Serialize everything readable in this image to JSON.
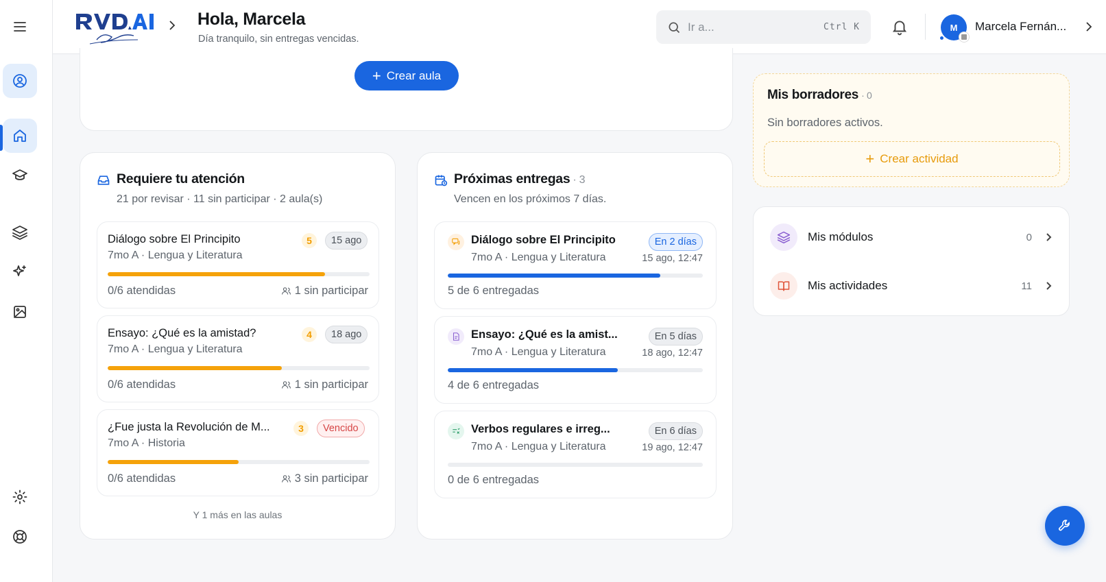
{
  "header": {
    "title": "Hola, Marcela",
    "subtitle": "Día tranquilo, sin entregas vencidas.",
    "search_placeholder": "Ir a...",
    "search_shortcut": "Ctrl K",
    "user_initial": "M",
    "user_name": "Marcela Fernán..."
  },
  "create_classroom_label": "Crear aula",
  "attention": {
    "title": "Requiere tu atención",
    "subtitle": "21 por revisar · 11 sin participar · 2 aula(s)",
    "items": [
      {
        "title": "Diálogo sobre El Principito",
        "meta": "7mo A · Lengua y Literatura",
        "count": "5",
        "date": "15 ago",
        "progress": 0.83,
        "attended": "0/6 atendidas",
        "missing": "1 sin participar"
      },
      {
        "title": "Ensayo: ¿Qué es la amistad?",
        "meta": "7mo A · Lengua y Literatura",
        "count": "4",
        "date": "18 ago",
        "progress": 0.665,
        "attended": "0/6 atendidas",
        "missing": "1 sin participar"
      },
      {
        "title": "¿Fue justa la Revolución de M...",
        "meta": "7mo A · Historia",
        "count": "3",
        "date": "Vencido",
        "progress": 0.5,
        "attended": "0/6 atendidas",
        "missing": "3 sin participar"
      }
    ],
    "more": "Y 1 más en las aulas"
  },
  "upcoming": {
    "title": "Próximas entregas",
    "count": "· 3",
    "subtitle": "Vencen en los próximos 7 días.",
    "items": [
      {
        "title": "Diálogo sobre El Principito",
        "meta": "7mo A · Lengua y Literatura",
        "badge": "En 2 días",
        "date": "15 ago, 12:47",
        "progress": 0.833,
        "delivered": "5 de 6 entregadas"
      },
      {
        "title": "Ensayo: ¿Qué es la amist...",
        "meta": "7mo A · Lengua y Literatura",
        "badge": "En 5 días",
        "date": "18 ago, 12:47",
        "progress": 0.667,
        "delivered": "4 de 6 entregadas"
      },
      {
        "title": "Verbos regulares e irreg...",
        "meta": "7mo A · Lengua y Literatura",
        "badge": "En 6 días",
        "date": "19 ago, 12:47",
        "progress": 0,
        "delivered": "0 de 6 entregadas"
      }
    ]
  },
  "drafts": {
    "title": "Mis borradores",
    "count": "· 0",
    "empty": "Sin borradores activos.",
    "create_label": "Crear actividad"
  },
  "library": {
    "modules_label": "Mis módulos",
    "modules_count": "0",
    "activities_label": "Mis actividades",
    "activities_count": "11"
  },
  "colors": {
    "accent": "#1a66e0",
    "warning": "#f5a20a",
    "danger": "#d64545"
  },
  "icons": [
    "menu-icon",
    "user-circle-icon",
    "home-icon",
    "graduation-cap-icon",
    "layers-icon",
    "sparkles-icon",
    "image-icon",
    "settings-icon",
    "lifebuoy-icon",
    "search-icon",
    "bell-icon",
    "inbox-icon",
    "calendar-icon",
    "chat-icon",
    "document-icon",
    "checklist-icon",
    "book-icon",
    "wrench-icon"
  ]
}
